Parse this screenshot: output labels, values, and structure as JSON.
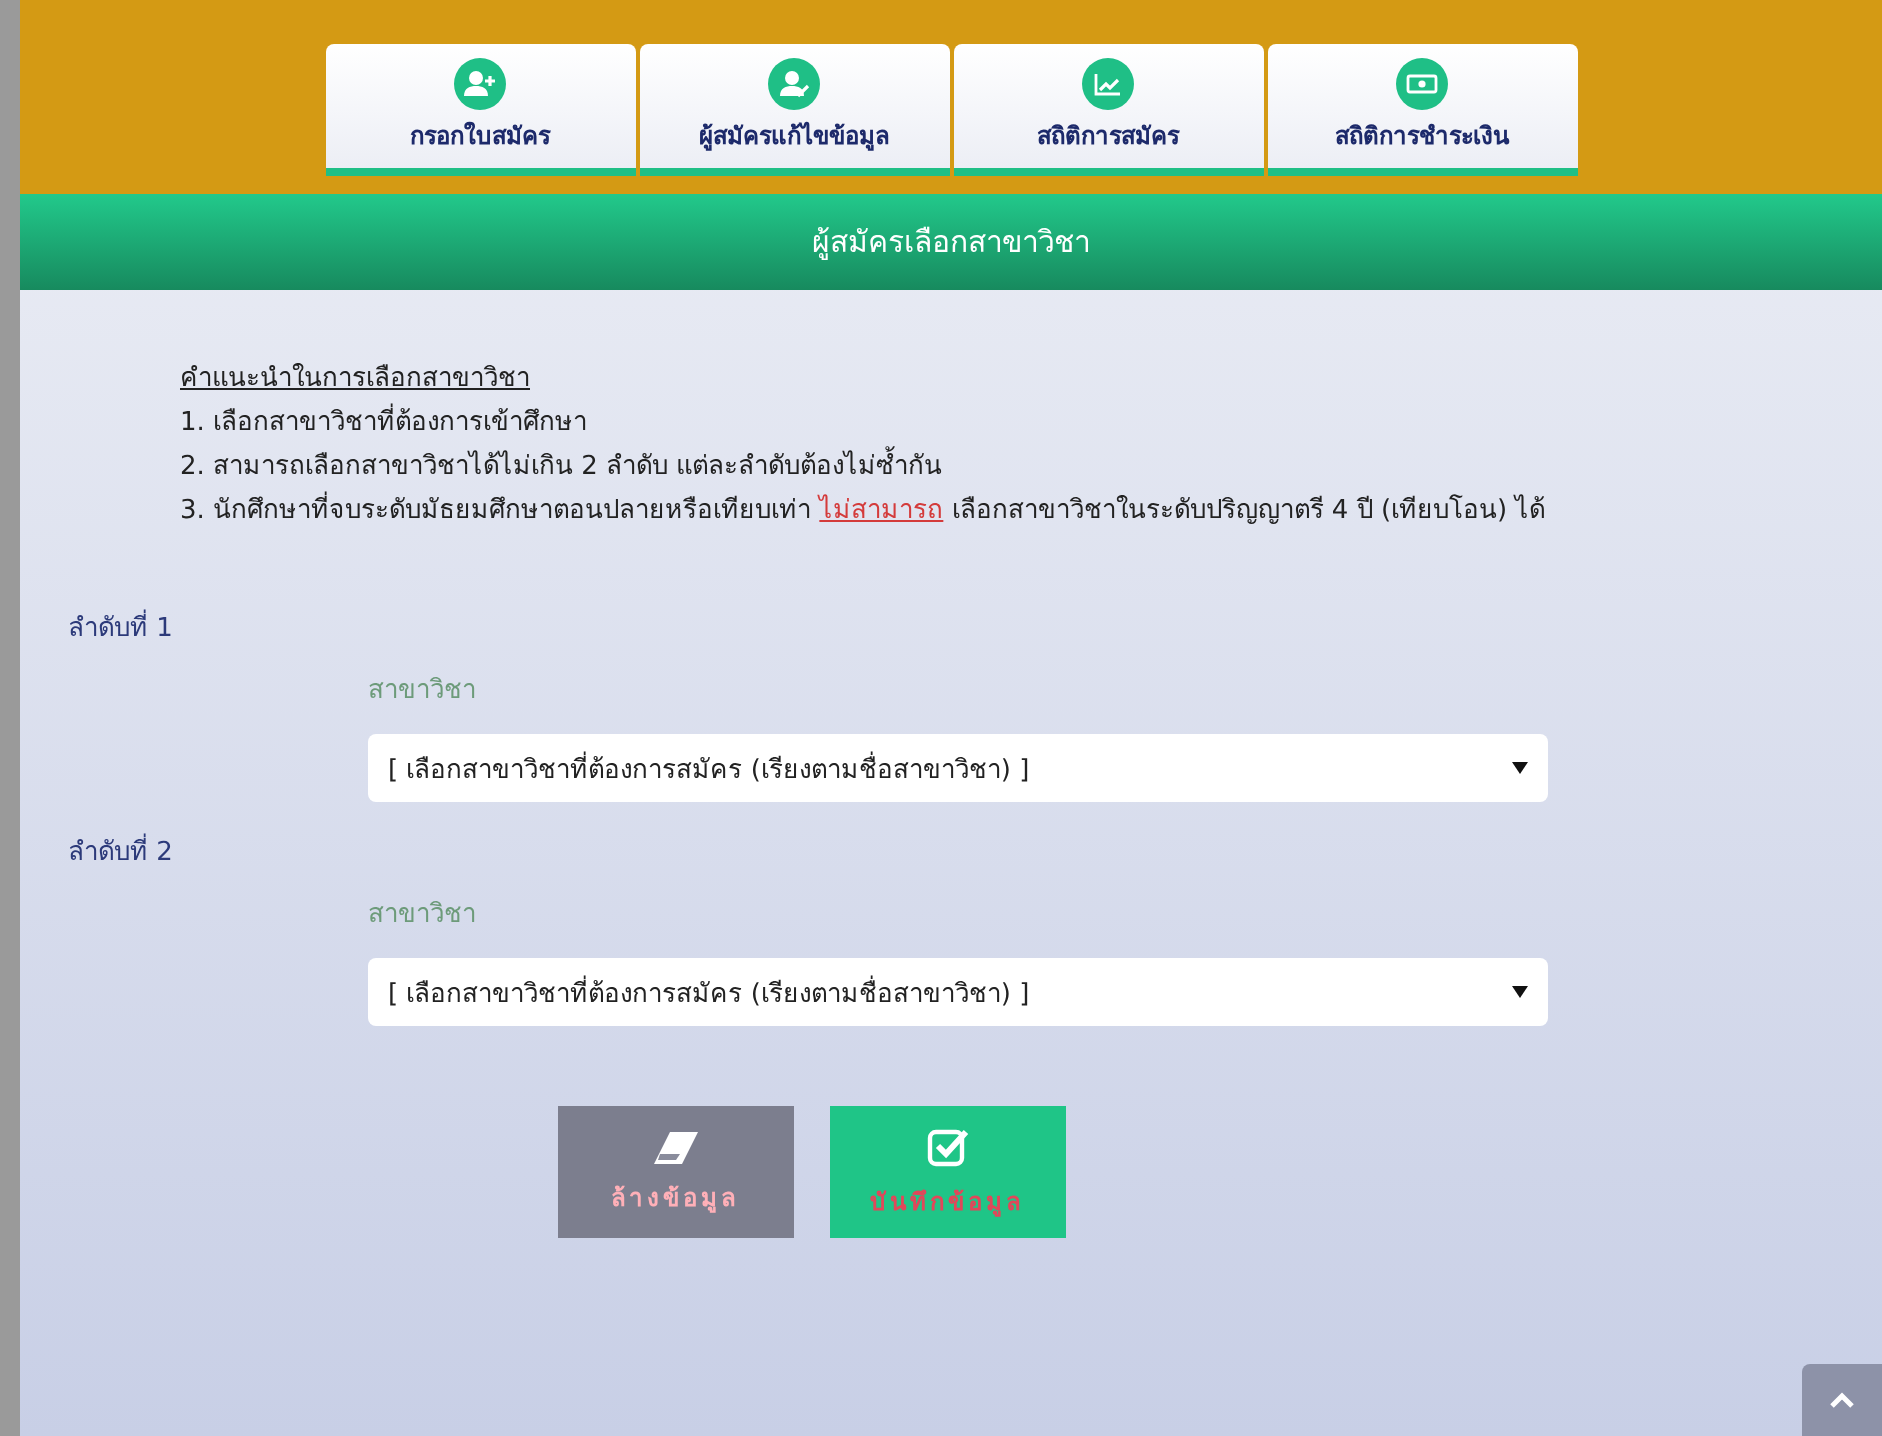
{
  "tabs": [
    {
      "label": "กรอกใบสมัคร",
      "kind": "register"
    },
    {
      "label": "ผู้สมัครแก้ไขข้อมูล",
      "kind": "edit"
    },
    {
      "label": "สถิติการสมัคร",
      "kind": "stats"
    },
    {
      "label": "สถิติการชำระเงิน",
      "kind": "payment"
    }
  ],
  "header": "ผู้สมัครเลือกสาขาวิชา",
  "instructions": {
    "title": "คำแนะนำในการเลือกสาขาวิชา",
    "items": [
      {
        "text": "1. เลือกสาขาวิชาที่ต้องการเข้าศึกษา"
      },
      {
        "text": "2. สามารถเลือกสาขาวิชาได้ไม่เกิน 2 ลำดับ แต่ละลำดับต้องไม่ซ้ำกัน"
      },
      {
        "text": "3. นักศึกษาที่จบระดับมัธยมศึกษาตอนปลายหรือเทียบเท่า ",
        "emphasis": "ไม่สามารถ",
        "after": " เลือกสาขาวิชาในระดับปริญญาตรี 4 ปี (เทียบโอน) ได้"
      }
    ]
  },
  "choices": [
    {
      "title": "ลำดับที่ 1",
      "label": "สาขาวิชา",
      "value": "[ เลือกสาขาวิชาที่ต้องการสมัคร (เรียงตามชื่อสาขาวิชา) ]"
    },
    {
      "title": "ลำดับที่ 2",
      "label": "สาขาวิชา",
      "value": "[ เลือกสาขาวิชาที่ต้องการสมัคร (เรียงตามชื่อสาขาวิชา) ]"
    }
  ],
  "buttons": [
    {
      "kind": "clear",
      "label": "ล้างข้อมูล"
    },
    {
      "kind": "save",
      "label": "บันทึกข้อมูล"
    }
  ]
}
